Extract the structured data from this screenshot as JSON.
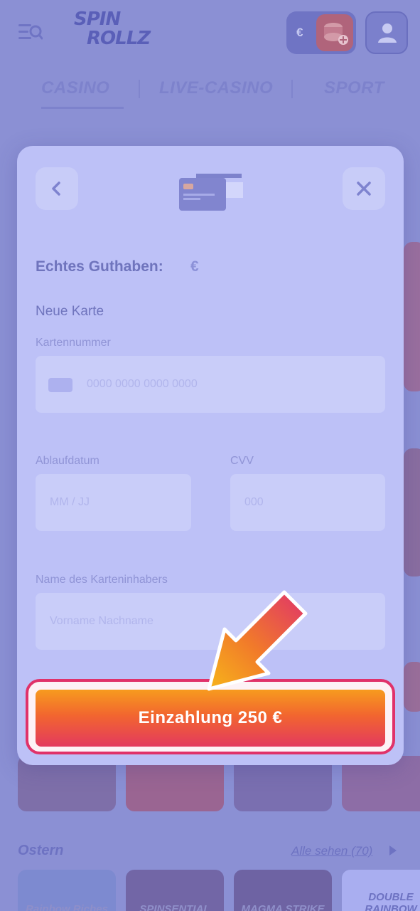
{
  "header": {
    "logo_line1": "SPIN",
    "logo_line2": "ROLLZ",
    "currency_symbol": "€"
  },
  "nav_tabs": [
    {
      "label": "CASINO"
    },
    {
      "label": "LIVE-CASINO"
    },
    {
      "label": "SPORT"
    }
  ],
  "games_section": {
    "title": "Ostern",
    "see_all": "Alle sehen (70)",
    "games": [
      {
        "label": "Rainbow Riches"
      },
      {
        "label": "SPINSENTIAL"
      },
      {
        "label": "MAGMA STRIKE"
      },
      {
        "label": "DOUBLE RAINBOW"
      }
    ]
  },
  "modal": {
    "balance_label": "Echtes Guthaben:",
    "balance_value": "€",
    "section_title": "Neue Karte",
    "card_number": {
      "label": "Kartennummer",
      "placeholder": "0000 0000 0000 0000"
    },
    "expiry": {
      "label": "Ablaufdatum",
      "placeholder": "MM / JJ"
    },
    "cvv": {
      "label": "CVV",
      "placeholder": "000"
    },
    "holder": {
      "label": "Name des Karteninhabers",
      "placeholder": "Vorname Nachname"
    },
    "deposit_button": "Einzahlung 250 €"
  },
  "colors": {
    "accent": "#e0326a",
    "button_top": "#f79b1e",
    "button_bottom": "#e33a5e",
    "overlay": "#8b90d4",
    "modal_bg": "#bdc1f7"
  }
}
